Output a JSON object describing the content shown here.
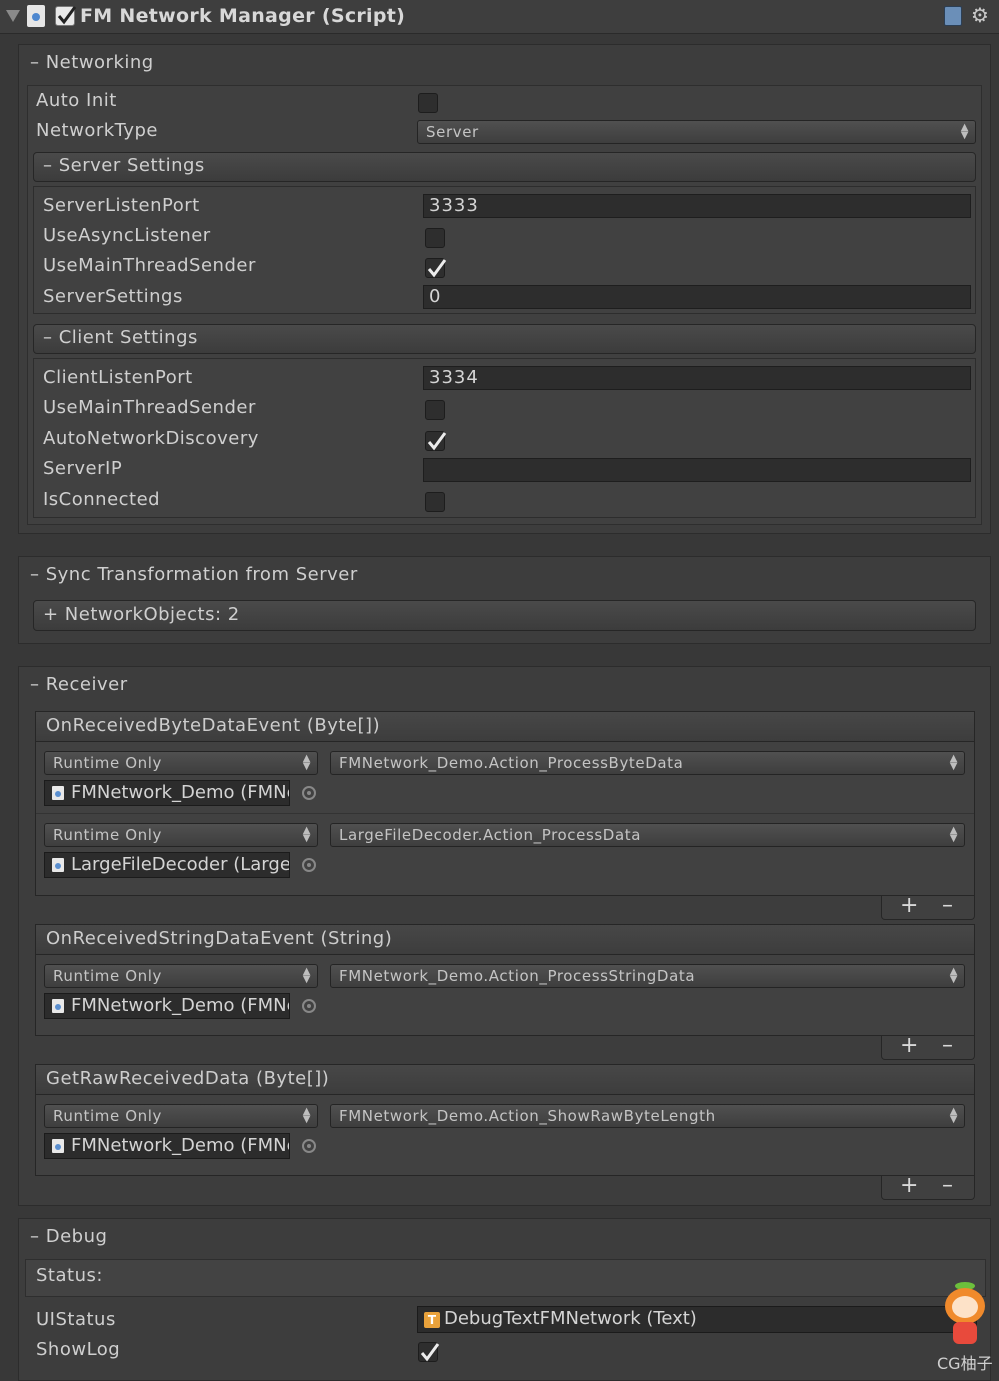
{
  "component": {
    "title": "FM Network Manager (Script)"
  },
  "networking": {
    "header": "– Networking",
    "auto_init_label": "Auto Init",
    "network_type_label": "NetworkType",
    "network_type_value": "Server",
    "server_settings": {
      "header": "– Server Settings",
      "listen_port_label": "ServerListenPort",
      "listen_port_value": "3333",
      "use_async_label": "UseAsyncListener",
      "use_main_thread_label": "UseMainThreadSender",
      "server_settings_label": "ServerSettings",
      "server_settings_value": "0"
    },
    "client_settings": {
      "header": "– Client Settings",
      "listen_port_label": "ClientListenPort",
      "listen_port_value": "3334",
      "use_main_thread_label": "UseMainThreadSender",
      "auto_discovery_label": "AutoNetworkDiscovery",
      "server_ip_label": "ServerIP",
      "server_ip_value": "",
      "is_connected_label": "IsConnected"
    }
  },
  "sync": {
    "header": "– Sync Transformation from Server",
    "network_objects": "+ NetworkObjects: 2"
  },
  "receiver": {
    "header": "– Receiver",
    "events": [
      {
        "title": "OnReceivedByteDataEvent (Byte[])"
      },
      {
        "title": "OnReceivedStringDataEvent (String)"
      },
      {
        "title": "GetRawReceivedData (Byte[])"
      }
    ],
    "listeners": [
      {
        "mode": "Runtime Only",
        "function": "FMNetwork_Demo.Action_ProcessByteData",
        "object": "FMNetwork_Demo (FMNe"
      },
      {
        "mode": "Runtime Only",
        "function": "LargeFileDecoder.Action_ProcessData",
        "object": "LargeFileDecoder (Large"
      },
      {
        "mode": "Runtime Only",
        "function": "FMNetwork_Demo.Action_ProcessStringData",
        "object": "FMNetwork_Demo (FMNe"
      },
      {
        "mode": "Runtime Only",
        "function": "FMNetwork_Demo.Action_ShowRawByteLength",
        "object": "FMNetwork_Demo (FMNe"
      }
    ],
    "plus": "+",
    "minus": "–"
  },
  "debug": {
    "header": "– Debug",
    "status_label": "Status:",
    "ui_status_label": "UIStatus",
    "ui_status_value": "DebugTextFMNetwork (Text)",
    "show_log_label": "ShowLog"
  },
  "watermark": {
    "text": "CG柚子"
  }
}
